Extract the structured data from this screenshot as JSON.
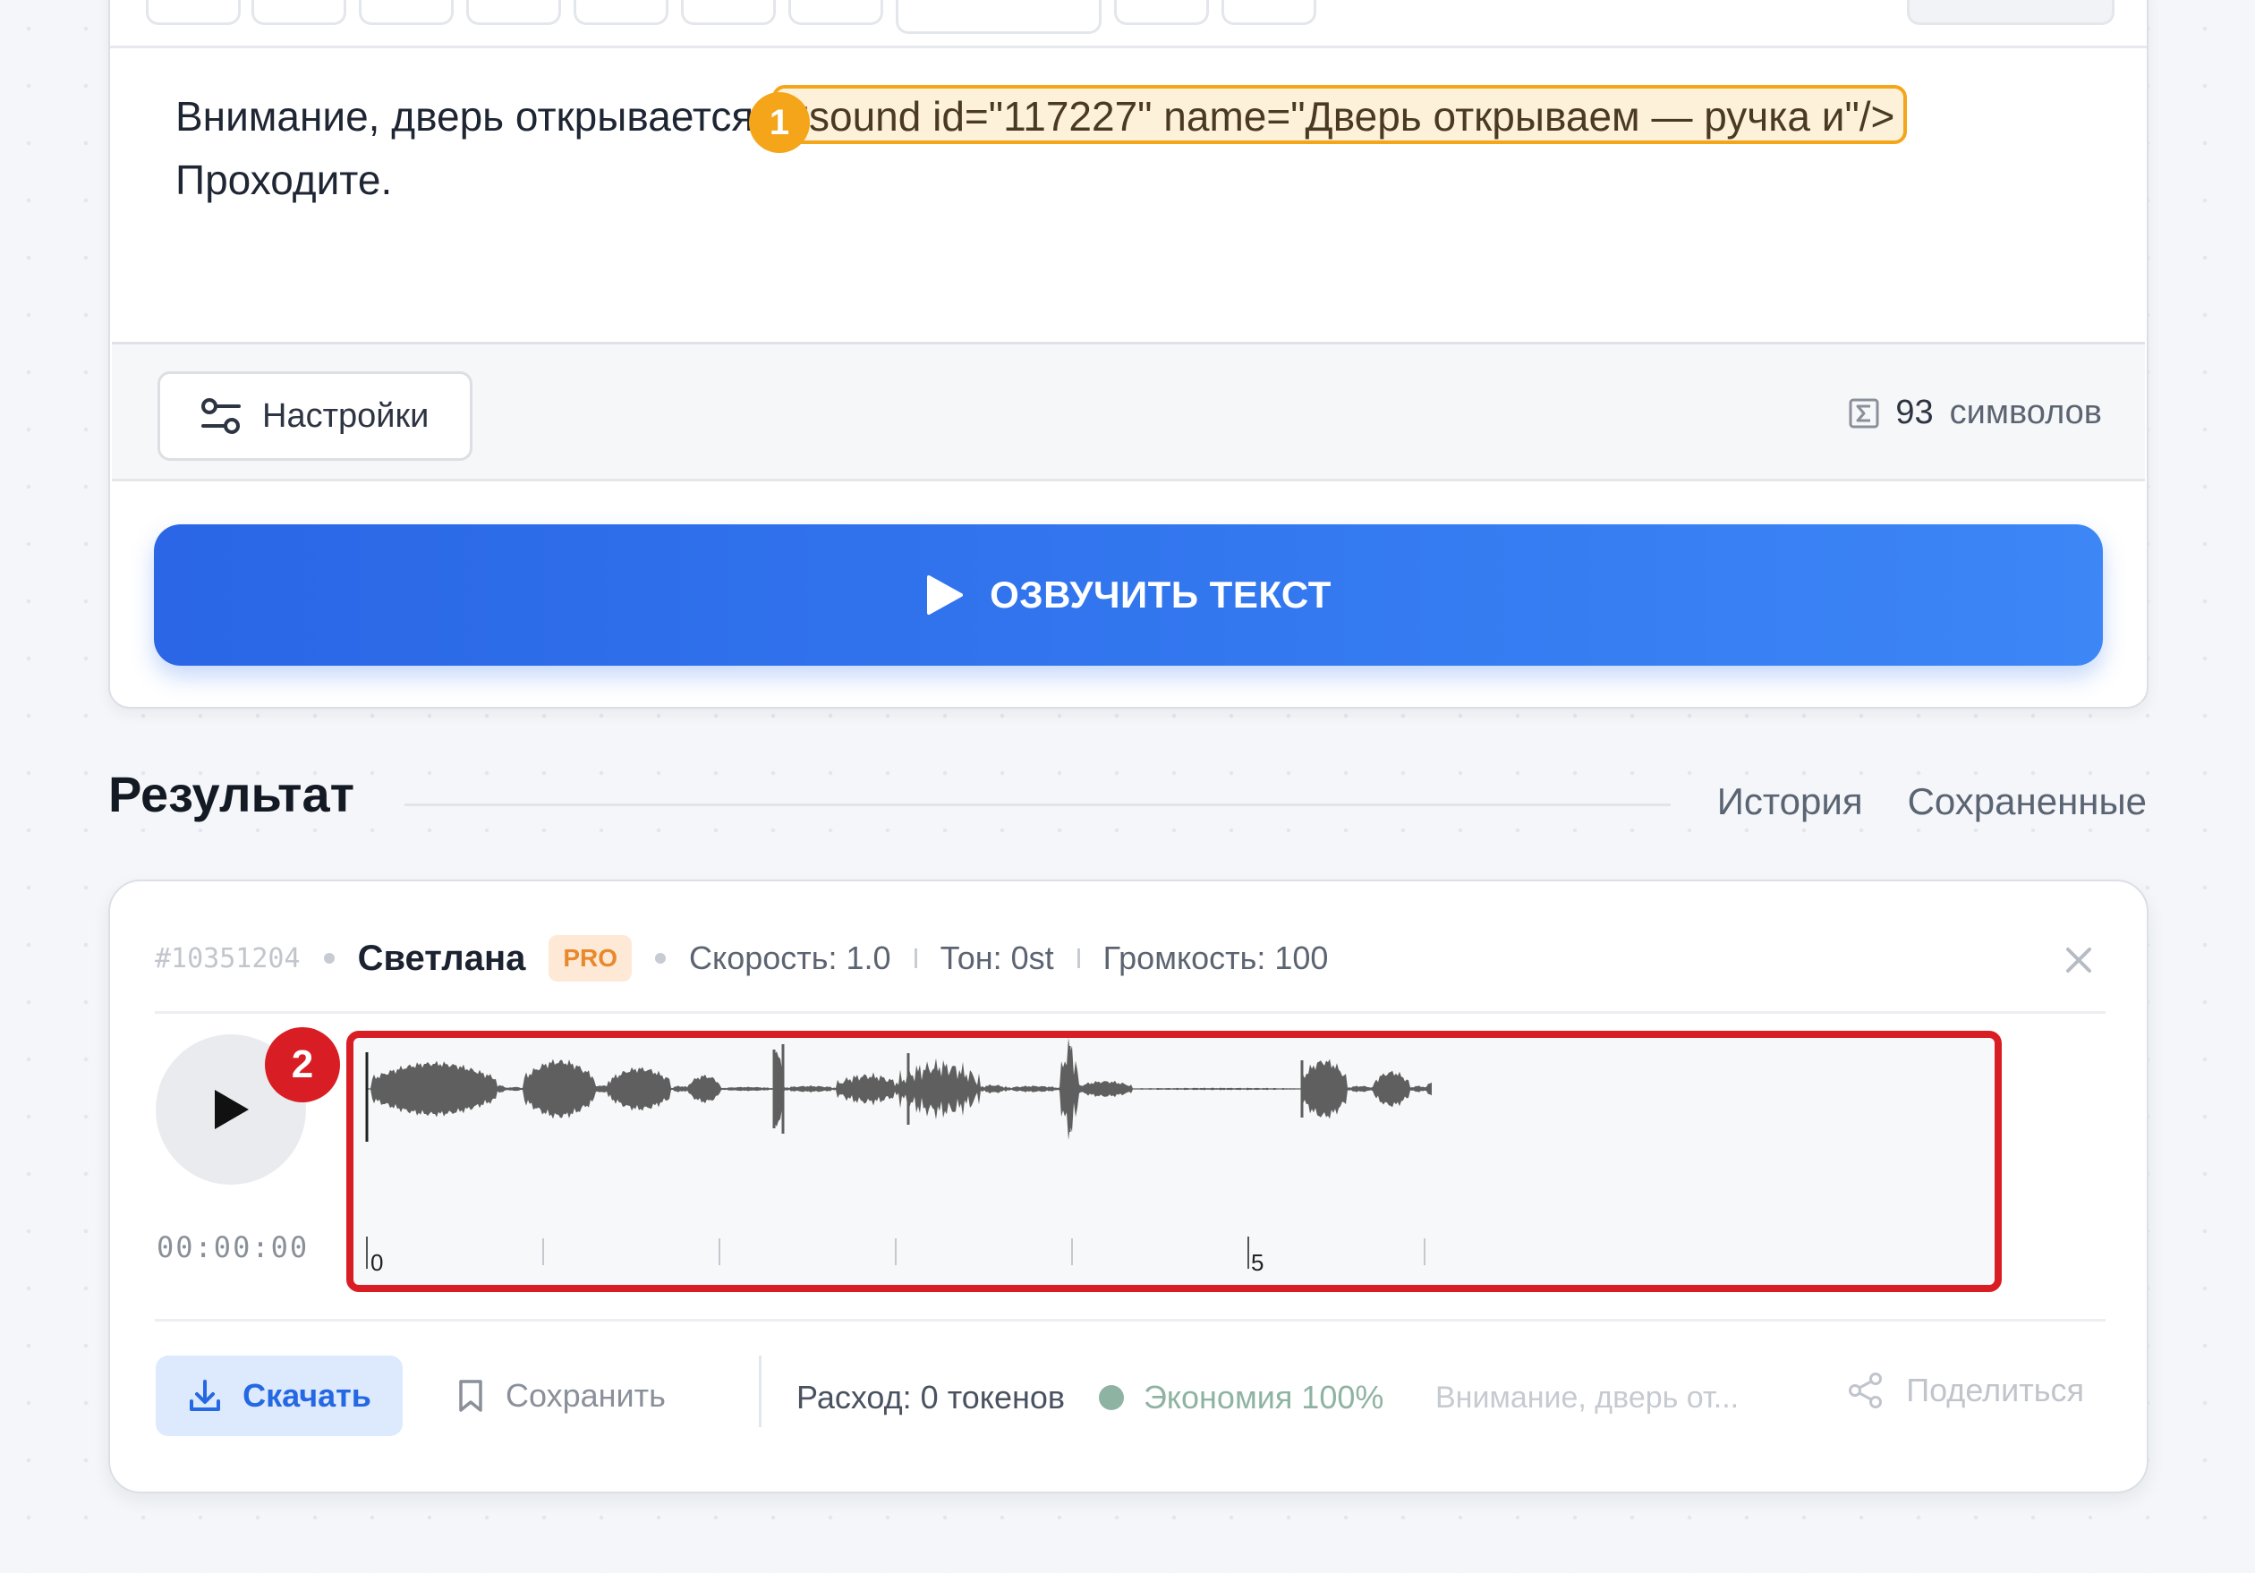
{
  "editor": {
    "text_before_tag": "Внимание, дверь открывается.",
    "sound_tag": "<sound id=\"117227\" name=\"Дверь открываем — ручка и\"/>",
    "text_line2": "Проходите.",
    "annotation_1": "1"
  },
  "settings": {
    "button_label": "Настройки",
    "char_count": "93",
    "char_unit": "символов"
  },
  "speak_button": {
    "label": "ОЗВУЧИТЬ ТЕКСТ"
  },
  "result": {
    "title": "Результат",
    "tabs": [
      "История",
      "Сохраненные"
    ],
    "item": {
      "id": "#10351204",
      "voice": "Светлана",
      "badge": "PRO",
      "speed": "Скорость: 1.0",
      "tone": "Тон: 0st",
      "volume": "Громкость: 100",
      "time": "00:00:00",
      "annotation_2": "2",
      "timeline_labels": [
        "0",
        "5"
      ]
    },
    "actions": {
      "download": "Скачать",
      "save": "Сохранить",
      "usage": "Расход: 0 токенов",
      "economy": "Экономия 100%",
      "preview": "Внимание, дверь от...",
      "share": "Поделиться"
    }
  },
  "colors": {
    "accent_blue": "#2f6fed",
    "annotation_orange": "#f4a51a",
    "annotation_red": "#d81e24",
    "waveform": "#5f5f5f"
  }
}
